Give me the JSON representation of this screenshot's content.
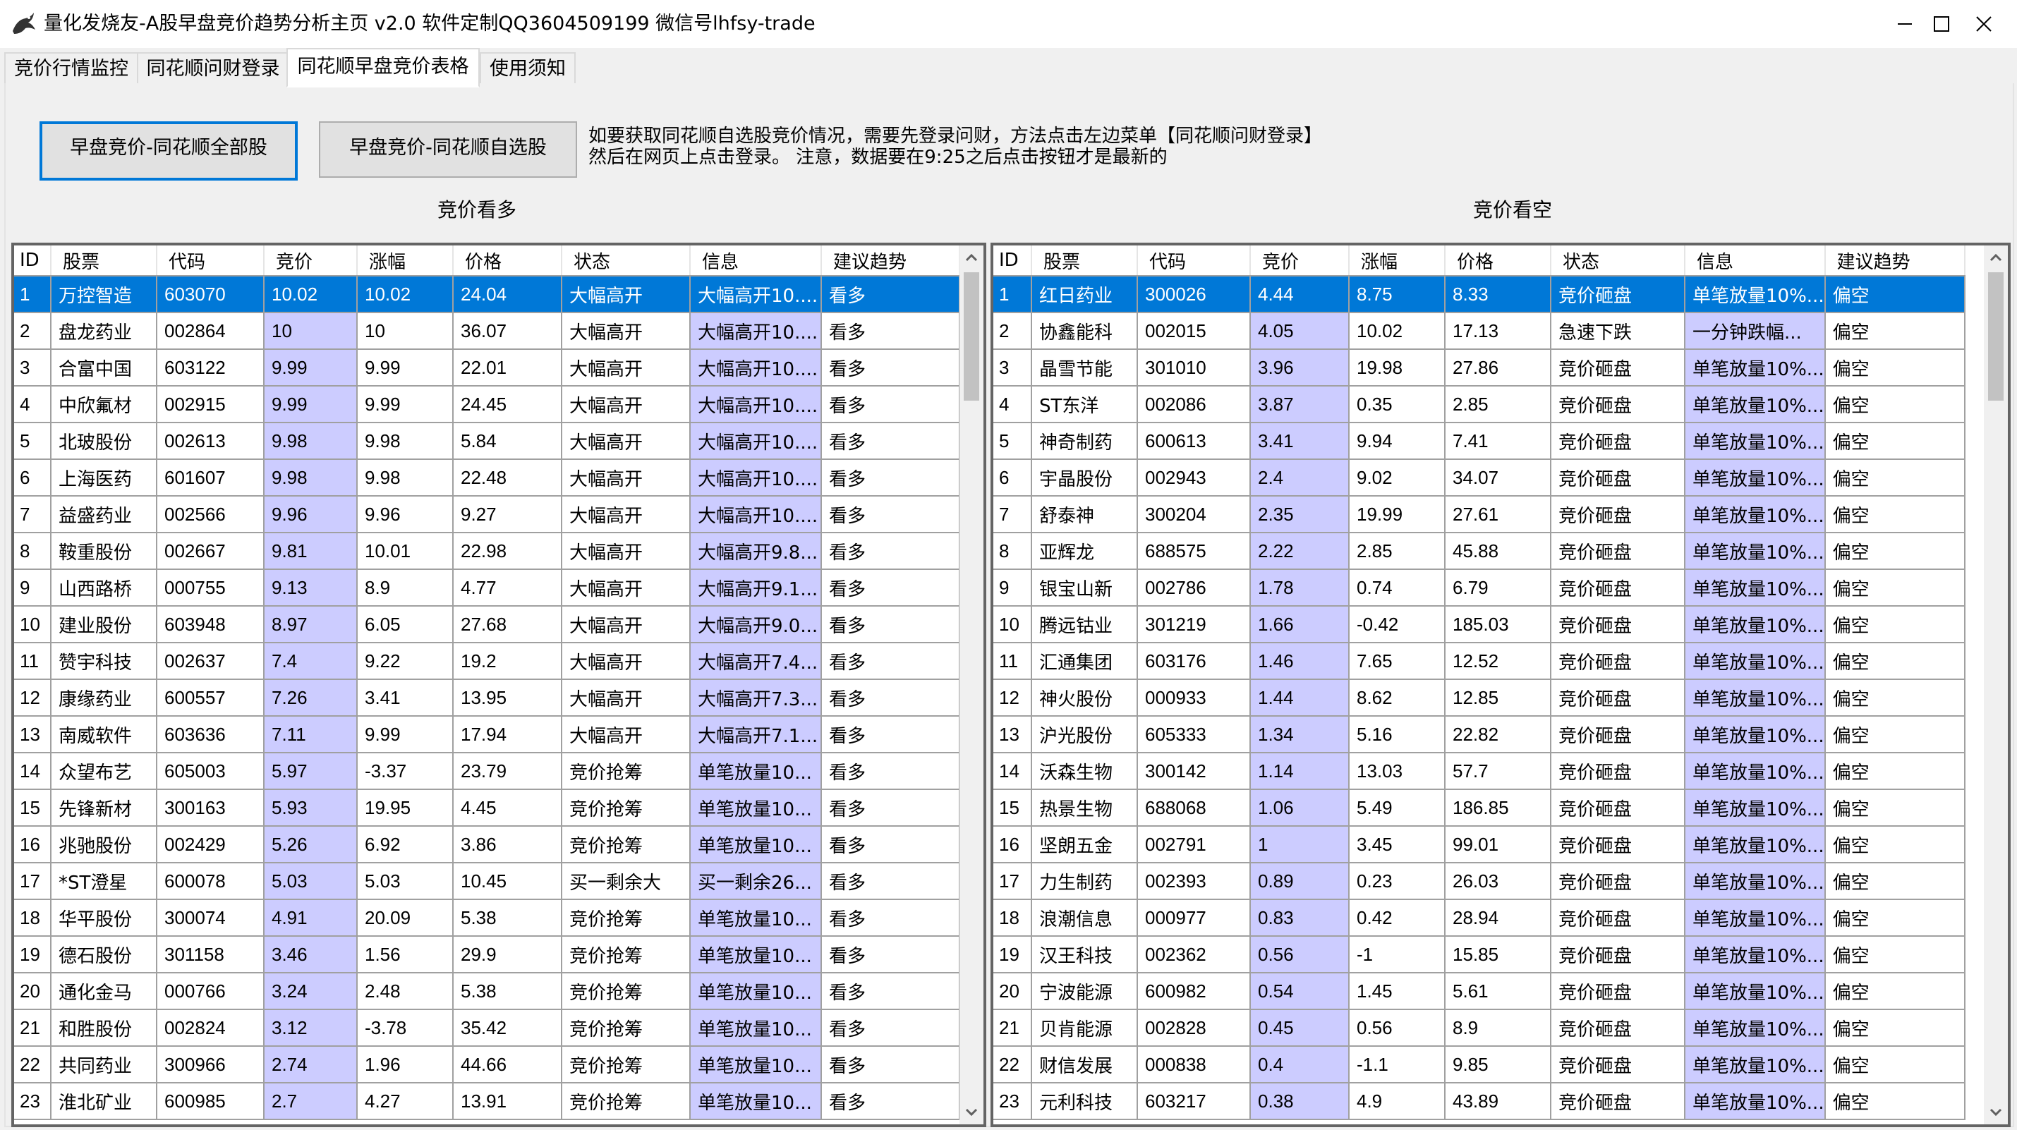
{
  "window": {
    "title": "量化发烧友-A股早盘竞价趋势分析主页 v2.0   软件定制QQ3604509199 微信号lhfsy-trade"
  },
  "tabs": [
    {
      "label": "竞价行情监控"
    },
    {
      "label": "同花顺问财登录"
    },
    {
      "label": "同花顺早盘竞价表格",
      "active": true
    },
    {
      "label": "使用须知"
    }
  ],
  "buttons": {
    "all_label": "早盘竞价-同花顺全部股",
    "custom_label": "早盘竞价-同花顺自选股"
  },
  "hint": {
    "line1": "如要获取同花顺自选股竞价情况，需要先登录问财，方法点击左边菜单【同花顺问财登录】",
    "line2": "然后在网页上点击登录。   注意，数据要在9:25之后点击按钮才是最新的"
  },
  "bull": {
    "title": "竞价看多",
    "columns": [
      "ID",
      "股票",
      "代码",
      "竞价",
      "涨幅",
      "价格",
      "状态",
      "信息",
      "建议趋势"
    ],
    "rows": [
      [
        "1",
        "万控智造",
        "603070",
        "10.02",
        "10.02",
        "24.04",
        "大幅高开",
        "大幅高开10....",
        "看多"
      ],
      [
        "2",
        "盘龙药业",
        "002864",
        "10",
        "10",
        "36.07",
        "大幅高开",
        "大幅高开10....",
        "看多"
      ],
      [
        "3",
        "合富中国",
        "603122",
        "9.99",
        "9.99",
        "22.01",
        "大幅高开",
        "大幅高开10....",
        "看多"
      ],
      [
        "4",
        "中欣氟材",
        "002915",
        "9.99",
        "9.99",
        "24.45",
        "大幅高开",
        "大幅高开10....",
        "看多"
      ],
      [
        "5",
        "北玻股份",
        "002613",
        "9.98",
        "9.98",
        "5.84",
        "大幅高开",
        "大幅高开10....",
        "看多"
      ],
      [
        "6",
        "上海医药",
        "601607",
        "9.98",
        "9.98",
        "22.48",
        "大幅高开",
        "大幅高开10....",
        "看多"
      ],
      [
        "7",
        "益盛药业",
        "002566",
        "9.96",
        "9.96",
        "9.27",
        "大幅高开",
        "大幅高开10....",
        "看多"
      ],
      [
        "8",
        "鞍重股份",
        "002667",
        "9.81",
        "10.01",
        "22.98",
        "大幅高开",
        "大幅高开9.8...",
        "看多"
      ],
      [
        "9",
        "山西路桥",
        "000755",
        "9.13",
        "8.9",
        "4.77",
        "大幅高开",
        "大幅高开9.1...",
        "看多"
      ],
      [
        "10",
        "建业股份",
        "603948",
        "8.97",
        "6.05",
        "27.68",
        "大幅高开",
        "大幅高开9.0...",
        "看多"
      ],
      [
        "11",
        "赞宇科技",
        "002637",
        "7.4",
        "9.22",
        "19.2",
        "大幅高开",
        "大幅高开7.4...",
        "看多"
      ],
      [
        "12",
        "康缘药业",
        "600557",
        "7.26",
        "3.41",
        "13.95",
        "大幅高开",
        "大幅高开7.3...",
        "看多"
      ],
      [
        "13",
        "南威软件",
        "603636",
        "7.11",
        "9.99",
        "17.94",
        "大幅高开",
        "大幅高开7.1...",
        "看多"
      ],
      [
        "14",
        "众望布艺",
        "605003",
        "5.97",
        "-3.37",
        "23.79",
        "竞价抢筹",
        "单笔放量10...",
        "看多"
      ],
      [
        "15",
        "先锋新材",
        "300163",
        "5.93",
        "19.95",
        "4.45",
        "竞价抢筹",
        "单笔放量10...",
        "看多"
      ],
      [
        "16",
        "兆驰股份",
        "002429",
        "5.26",
        "6.92",
        "3.86",
        "竞价抢筹",
        "单笔放量10...",
        "看多"
      ],
      [
        "17",
        "*ST澄星",
        "600078",
        "5.03",
        "5.03",
        "10.45",
        "买一剩余大",
        "买一剩余26...",
        "看多"
      ],
      [
        "18",
        "华平股份",
        "300074",
        "4.91",
        "20.09",
        "5.38",
        "竞价抢筹",
        "单笔放量10...",
        "看多"
      ],
      [
        "19",
        "德石股份",
        "301158",
        "3.46",
        "1.56",
        "29.9",
        "竞价抢筹",
        "单笔放量10...",
        "看多"
      ],
      [
        "20",
        "通化金马",
        "000766",
        "3.24",
        "2.48",
        "5.38",
        "竞价抢筹",
        "单笔放量10...",
        "看多"
      ],
      [
        "21",
        "和胜股份",
        "002824",
        "3.12",
        "-3.78",
        "35.42",
        "竞价抢筹",
        "单笔放量10...",
        "看多"
      ],
      [
        "22",
        "共同药业",
        "300966",
        "2.74",
        "1.96",
        "44.66",
        "竞价抢筹",
        "单笔放量10...",
        "看多"
      ],
      [
        "23",
        "淮北矿业",
        "600985",
        "2.7",
        "4.27",
        "13.91",
        "竞价抢筹",
        "单笔放量10...",
        "看多"
      ]
    ]
  },
  "bear": {
    "title": "竞价看空",
    "columns": [
      "ID",
      "股票",
      "代码",
      "竞价",
      "涨幅",
      "价格",
      "状态",
      "信息",
      "建议趋势"
    ],
    "rows": [
      [
        "1",
        "红日药业",
        "300026",
        "4.44",
        "8.75",
        "8.33",
        "竞价砸盘",
        "单笔放量10%...",
        "偏空"
      ],
      [
        "2",
        "协鑫能科",
        "002015",
        "4.05",
        "10.02",
        "17.13",
        "急速下跌",
        "一分钟跌幅...",
        "偏空"
      ],
      [
        "3",
        "晶雪节能",
        "301010",
        "3.96",
        "19.98",
        "27.86",
        "竞价砸盘",
        "单笔放量10%...",
        "偏空"
      ],
      [
        "4",
        "ST东洋",
        "002086",
        "3.87",
        "0.35",
        "2.85",
        "竞价砸盘",
        "单笔放量10%...",
        "偏空"
      ],
      [
        "5",
        "神奇制药",
        "600613",
        "3.41",
        "9.94",
        "7.41",
        "竞价砸盘",
        "单笔放量10%...",
        "偏空"
      ],
      [
        "6",
        "宇晶股份",
        "002943",
        "2.4",
        "9.02",
        "34.07",
        "竞价砸盘",
        "单笔放量10%...",
        "偏空"
      ],
      [
        "7",
        "舒泰神",
        "300204",
        "2.35",
        "19.99",
        "27.61",
        "竞价砸盘",
        "单笔放量10%...",
        "偏空"
      ],
      [
        "8",
        "亚辉龙",
        "688575",
        "2.22",
        "2.85",
        "45.88",
        "竞价砸盘",
        "单笔放量10%...",
        "偏空"
      ],
      [
        "9",
        "银宝山新",
        "002786",
        "1.78",
        "0.74",
        "6.79",
        "竞价砸盘",
        "单笔放量10%...",
        "偏空"
      ],
      [
        "10",
        "腾远钴业",
        "301219",
        "1.66",
        "-0.42",
        "185.03",
        "竞价砸盘",
        "单笔放量10%...",
        "偏空"
      ],
      [
        "11",
        "汇通集团",
        "603176",
        "1.46",
        "7.65",
        "12.52",
        "竞价砸盘",
        "单笔放量10%...",
        "偏空"
      ],
      [
        "12",
        "神火股份",
        "000933",
        "1.44",
        "8.62",
        "12.85",
        "竞价砸盘",
        "单笔放量10%...",
        "偏空"
      ],
      [
        "13",
        "沪光股份",
        "605333",
        "1.34",
        "5.16",
        "22.82",
        "竞价砸盘",
        "单笔放量10%...",
        "偏空"
      ],
      [
        "14",
        "沃森生物",
        "300142",
        "1.14",
        "13.03",
        "57.7",
        "竞价砸盘",
        "单笔放量10%...",
        "偏空"
      ],
      [
        "15",
        "热景生物",
        "688068",
        "1.06",
        "5.49",
        "186.85",
        "竞价砸盘",
        "单笔放量10%...",
        "偏空"
      ],
      [
        "16",
        "坚朗五金",
        "002791",
        "1",
        "3.45",
        "99.01",
        "竞价砸盘",
        "单笔放量10%...",
        "偏空"
      ],
      [
        "17",
        "力生制药",
        "002393",
        "0.89",
        "0.23",
        "26.03",
        "竞价砸盘",
        "单笔放量10%...",
        "偏空"
      ],
      [
        "18",
        "浪潮信息",
        "000977",
        "0.83",
        "0.42",
        "28.94",
        "竞价砸盘",
        "单笔放量10%...",
        "偏空"
      ],
      [
        "19",
        "汉王科技",
        "002362",
        "0.56",
        "-1",
        "15.85",
        "竞价砸盘",
        "单笔放量10%...",
        "偏空"
      ],
      [
        "20",
        "宁波能源",
        "600982",
        "0.54",
        "1.45",
        "5.61",
        "竞价砸盘",
        "单笔放量10%...",
        "偏空"
      ],
      [
        "21",
        "贝肯能源",
        "002828",
        "0.45",
        "0.56",
        "8.9",
        "竞价砸盘",
        "单笔放量10%...",
        "偏空"
      ],
      [
        "22",
        "财信发展",
        "000838",
        "0.4",
        "-1.1",
        "9.85",
        "竞价砸盘",
        "单笔放量10%...",
        "偏空"
      ],
      [
        "23",
        "元利科技",
        "603217",
        "0.38",
        "4.9",
        "43.89",
        "竞价砸盘",
        "单笔放量10%...",
        "偏空"
      ]
    ]
  },
  "colors": {
    "selection": "#0078d7",
    "highlight_cell": "#ccccff",
    "focus_border": "#0078d7"
  }
}
